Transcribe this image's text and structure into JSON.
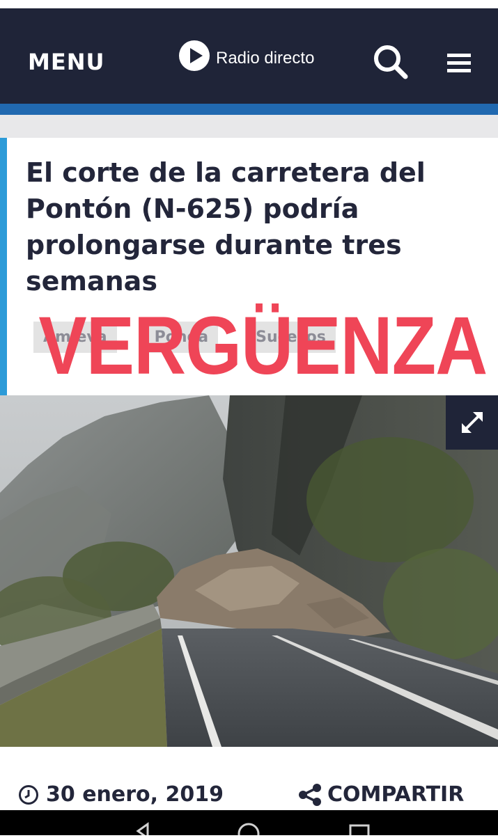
{
  "header": {
    "menu_label": "MENU",
    "radio_label": "Radio directo",
    "search_icon": "search-icon",
    "hamburger_icon": "hamburger-icon",
    "background_color": "#1f2438",
    "accent_bar_color": "#2169b0"
  },
  "article": {
    "title": "El corte de la carretera del Pontón (N-625) podría prolongarse durante tres semanas",
    "tags": [
      {
        "label": "Amieva"
      },
      {
        "label": "Ponga"
      },
      {
        "label": "Sucesos"
      }
    ],
    "overlay_text": "VERGÜENZA",
    "overlay_color": "#ef4557",
    "accent_color": "#2d9bd8",
    "expand_icon": "expand-icon",
    "date": "30 enero, 2019",
    "date_icon": "clock-icon",
    "share_label": "COMPARTIR",
    "share_icon": "share-icon"
  },
  "system_nav": {
    "icons": [
      "back-icon",
      "home-icon",
      "recents-icon"
    ]
  }
}
